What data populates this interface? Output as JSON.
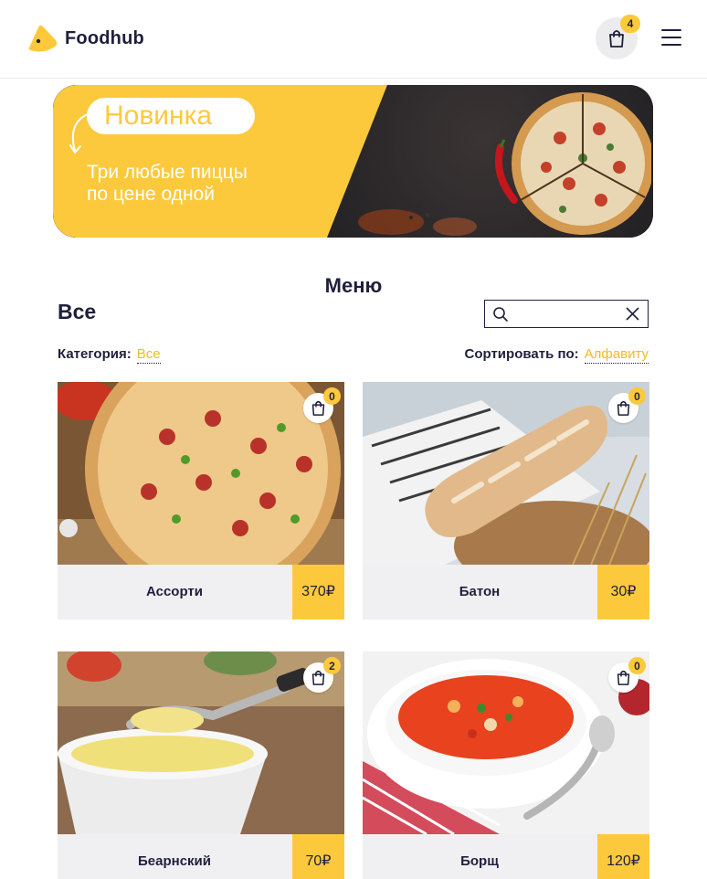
{
  "header": {
    "brand": "Foodhub",
    "cart_count": "4"
  },
  "banner": {
    "badge": "Новинка",
    "text": "Три любые пиццы\nпо цене одной"
  },
  "menu": {
    "title": "Меню",
    "category_title": "Все",
    "search": {
      "placeholder": ""
    },
    "category_label": "Категория:",
    "category_value": "Все",
    "sort_label": "Сортировать по:",
    "sort_value": "Алфавиту"
  },
  "products": [
    {
      "name": "Ассорти",
      "price": "370₽",
      "count": "0",
      "image": "pizza"
    },
    {
      "name": "Батон",
      "price": "30₽",
      "count": "0",
      "image": "bread"
    },
    {
      "name": "Беарнский",
      "price": "70₽",
      "count": "2",
      "image": "sauce"
    },
    {
      "name": "Борщ",
      "price": "120₽",
      "count": "0",
      "image": "soup"
    }
  ],
  "colors": {
    "accent": "#fdc93c",
    "text": "#1f1f3d",
    "card_footer": "#f0f0f3",
    "link": "#f0bb22"
  }
}
